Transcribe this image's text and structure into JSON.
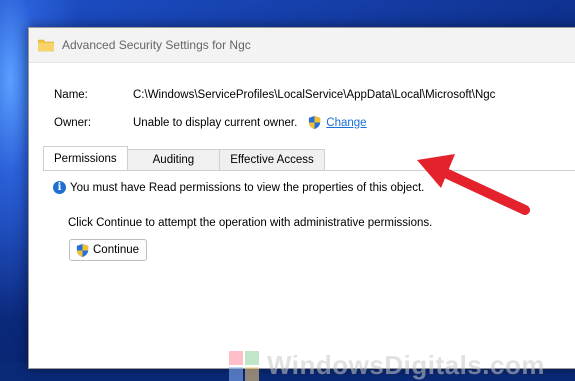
{
  "window": {
    "title": "Advanced Security Settings for Ngc"
  },
  "fields": {
    "name_label": "Name:",
    "name_value": "C:\\Windows\\ServiceProfiles\\LocalService\\AppData\\Local\\Microsoft\\Ngc",
    "owner_label": "Owner:",
    "owner_value": "Unable to display current owner.",
    "change_link": "Change"
  },
  "tabs": [
    {
      "label": "Permissions",
      "active": true
    },
    {
      "label": "Auditing",
      "active": false
    },
    {
      "label": "Effective Access",
      "active": false
    }
  ],
  "panel": {
    "info_message": "You must have Read permissions to view the properties of this object.",
    "hint": "Click Continue to attempt the operation with administrative permissions.",
    "continue_label": "Continue"
  },
  "watermark": {
    "text": "WindowsDigitals.com"
  },
  "colors": {
    "link": "#1a6fd6",
    "arrow": "#e3222b",
    "info": "#1f6fd1"
  },
  "icons": {
    "title": "folder-icon",
    "owner": "uac-shield-icon",
    "info": "info-icon",
    "continue": "uac-shield-icon"
  }
}
